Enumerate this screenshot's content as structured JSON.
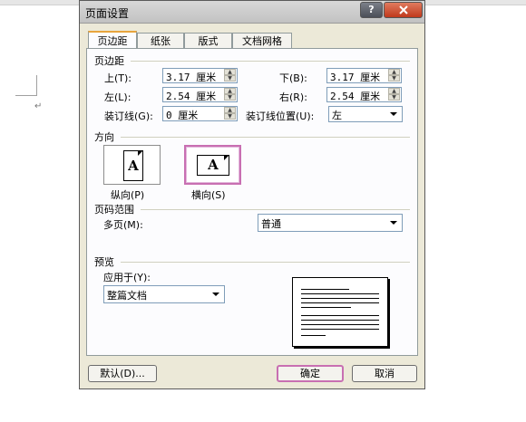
{
  "dialog": {
    "title": "页面设置",
    "help_button": "?",
    "close_button": "x"
  },
  "tabs": [
    "页边距",
    "纸张",
    "版式",
    "文档网格"
  ],
  "margins": {
    "heading": "页边距",
    "top_label": "上(T):",
    "top_value": "3.17 厘米",
    "bottom_label": "下(B):",
    "bottom_value": "3.17 厘米",
    "left_label": "左(L):",
    "left_value": "2.54 厘米",
    "right_label": "右(R):",
    "right_value": "2.54 厘米",
    "gutter_label": "装订线(G):",
    "gutter_value": "0 厘米",
    "gutter_pos_label": "装订线位置(U):",
    "gutter_pos_value": "左"
  },
  "orientation": {
    "heading": "方向",
    "portrait_label": "纵向(P)",
    "landscape_label": "横向(S)",
    "icon_letter": "A",
    "selected": "landscape"
  },
  "pages": {
    "heading": "页码范围",
    "multi_label": "多页(M):",
    "multi_value": "普通"
  },
  "preview": {
    "heading": "预览",
    "apply_label": "应用于(Y):",
    "apply_value": "整篇文档"
  },
  "buttons": {
    "default": "默认(D)...",
    "ok": "确定",
    "cancel": "取消"
  },
  "document": {
    "paragraph_mark": "↵"
  },
  "colors": {
    "dialog_bg": "#ece9d8",
    "panel_bg": "#fcfcfe",
    "focus_border": "#c86fb2",
    "close_button": "#c0391c"
  }
}
